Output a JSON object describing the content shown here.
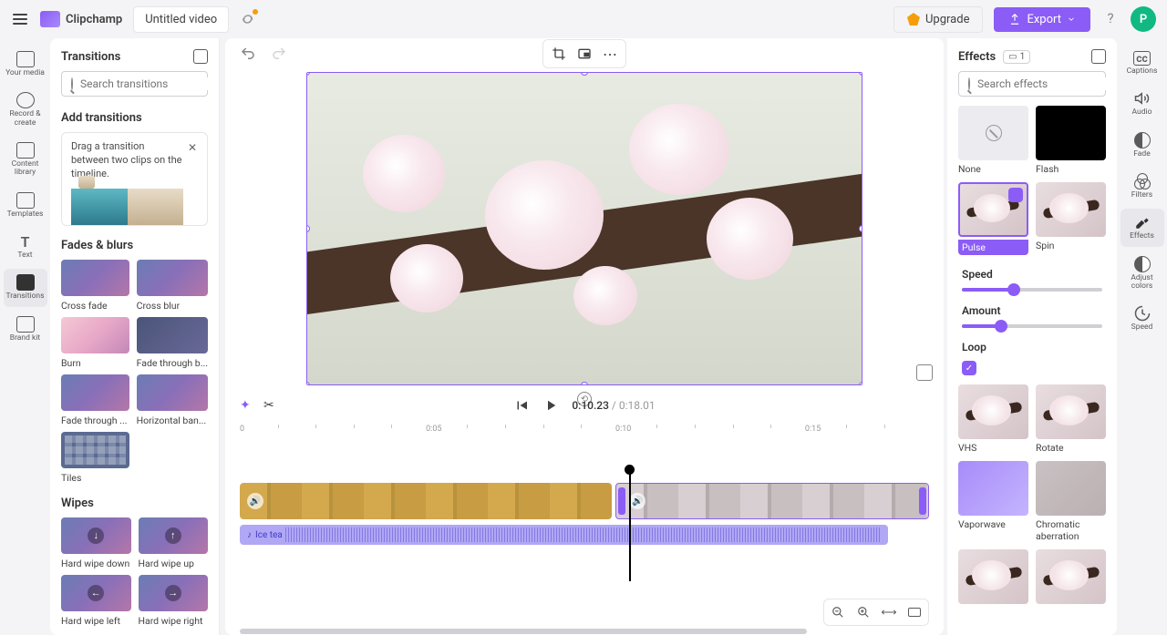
{
  "app": {
    "name": "Clipchamp",
    "project": "Untitled video"
  },
  "topbar": {
    "upgrade": "Upgrade",
    "export": "Export",
    "avatar": "P"
  },
  "leftSidebar": {
    "items": [
      {
        "label": "Your media"
      },
      {
        "label": "Record & create"
      },
      {
        "label": "Content library"
      },
      {
        "label": "Templates"
      },
      {
        "label": "Text"
      },
      {
        "label": "Transitions"
      },
      {
        "label": "Brand kit"
      }
    ]
  },
  "transitions": {
    "title": "Transitions",
    "searchPlaceholder": "Search transitions",
    "addTitle": "Add transitions",
    "hint": "Drag a transition between two clips on the timeline.",
    "sections": {
      "fadesBlurs": {
        "title": "Fades & blurs",
        "items": [
          "Cross fade",
          "Cross blur",
          "Burn",
          "Fade through b...",
          "Fade through ...",
          "Horizontal ban...",
          "Tiles"
        ]
      },
      "wipes": {
        "title": "Wipes",
        "items": [
          "Hard wipe down",
          "Hard wipe up",
          "Hard wipe left",
          "Hard wipe right"
        ]
      }
    }
  },
  "playback": {
    "current": "0:10.23",
    "duration": "0:18.01",
    "ruler": [
      "0",
      "0:05",
      "0:10",
      "0:15"
    ]
  },
  "timeline": {
    "audioClip": "Ice tea"
  },
  "effects": {
    "title": "Effects",
    "count": "1",
    "searchPlaceholder": "Search effects",
    "items": [
      "None",
      "Flash",
      "Pulse",
      "Spin",
      "VHS",
      "Rotate",
      "Vaporwave",
      "Chromatic aberration"
    ],
    "params": {
      "speed": {
        "label": "Speed",
        "percent": 37
      },
      "amount": {
        "label": "Amount",
        "percent": 28
      },
      "loop": {
        "label": "Loop",
        "checked": true
      }
    }
  },
  "rightSidebar": {
    "items": [
      "Captions",
      "Audio",
      "Fade",
      "Filters",
      "Effects",
      "Adjust colors",
      "Speed"
    ]
  }
}
